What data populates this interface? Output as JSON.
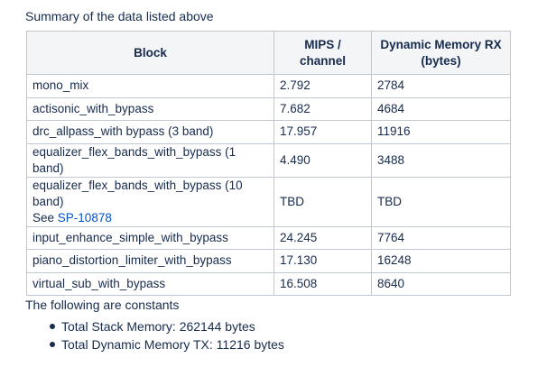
{
  "summary_heading": "Summary of the data listed above",
  "table": {
    "headers": {
      "block": "Block",
      "mips": "MIPS / channel",
      "dyn_mem_line1": "Dynamic Memory RX",
      "dyn_mem_line2": "(bytes)"
    },
    "rows": [
      {
        "block": "mono_mix",
        "mips": "2.792",
        "mem": "2784"
      },
      {
        "block": "actisonic_with_bypass",
        "mips": "7.682",
        "mem": "4684"
      },
      {
        "block": "drc_allpass_with bypass (3 band)",
        "mips": "17.957",
        "mem": "11916"
      },
      {
        "block": "equalizer_flex_bands_with_bypass (1 band)",
        "mips": "4.490",
        "mem": "3488"
      },
      {
        "block": "equalizer_flex_bands_with_bypass (10 band)",
        "see": "See",
        "link": "SP-10878",
        "mips": "TBD",
        "mem": "TBD"
      },
      {
        "block": "input_enhance_simple_with_bypass",
        "mips": "24.245",
        "mem": "7764"
      },
      {
        "block": "piano_distortion_limiter_with_bypass",
        "mips": "17.130",
        "mem": "16248"
      },
      {
        "block": "virtual_sub_with_bypass",
        "mips": "16.508",
        "mem": "8640"
      }
    ]
  },
  "constants_heading": "The following are constants",
  "constants": [
    "Total Stack Memory: 262144 bytes",
    "Total Dynamic Memory TX: 11216 bytes"
  ]
}
